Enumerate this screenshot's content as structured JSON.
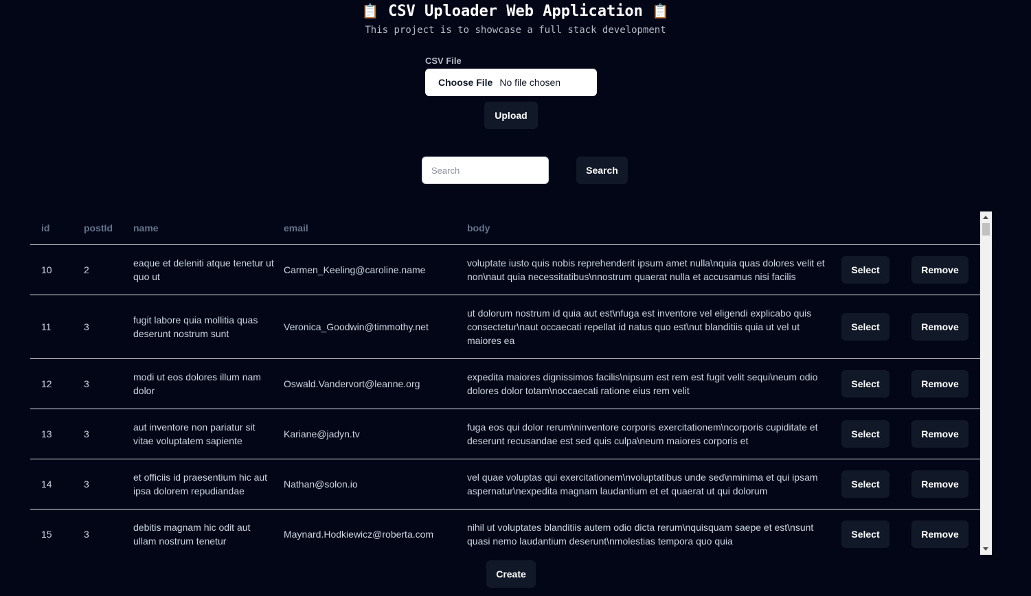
{
  "header": {
    "icon_left": "📋",
    "title": "CSV Uploader Web Application",
    "icon_right": "📋",
    "subtitle": "This project is to showcase a full stack development"
  },
  "upload": {
    "label": "CSV File",
    "choose_label": "Choose File",
    "file_status": "No file chosen",
    "button": "Upload"
  },
  "search": {
    "placeholder": "Search",
    "value": "",
    "button": "Search"
  },
  "table": {
    "columns": [
      "id",
      "postId",
      "name",
      "email",
      "body"
    ],
    "select_label": "Select",
    "remove_label": "Remove",
    "rows": [
      {
        "id": "10",
        "postId": "2",
        "name": "eaque et deleniti atque tenetur ut quo ut",
        "email": "Carmen_Keeling@caroline.name",
        "body": "voluptate iusto quis nobis reprehenderit ipsum amet nulla\\nquia quas dolores velit et non\\naut quia necessitatibus\\nnostrum quaerat nulla et accusamus nisi facilis"
      },
      {
        "id": "11",
        "postId": "3",
        "name": "fugit labore quia mollitia quas deserunt nostrum sunt",
        "email": "Veronica_Goodwin@timmothy.net",
        "body": "ut dolorum nostrum id quia aut est\\nfuga est inventore vel eligendi explicabo quis consectetur\\naut occaecati repellat id natus quo est\\nut blanditiis quia ut vel ut maiores ea"
      },
      {
        "id": "12",
        "postId": "3",
        "name": "modi ut eos dolores illum nam dolor",
        "email": "Oswald.Vandervort@leanne.org",
        "body": "expedita maiores dignissimos facilis\\nipsum est rem est fugit velit sequi\\neum odio dolores dolor totam\\noccaecati ratione eius rem velit"
      },
      {
        "id": "13",
        "postId": "3",
        "name": "aut inventore non pariatur sit vitae voluptatem sapiente",
        "email": "Kariane@jadyn.tv",
        "body": "fuga eos qui dolor rerum\\ninventore corporis exercitationem\\ncorporis cupiditate et deserunt recusandae est sed quis culpa\\neum maiores corporis et"
      },
      {
        "id": "14",
        "postId": "3",
        "name": "et officiis id praesentium hic aut ipsa dolorem repudiandae",
        "email": "Nathan@solon.io",
        "body": "vel quae voluptas qui exercitationem\\nvoluptatibus unde sed\\nminima et qui ipsam aspernatur\\nexpedita magnam laudantium et et quaerat ut qui dolorum"
      },
      {
        "id": "15",
        "postId": "3",
        "name": "debitis magnam hic odit aut ullam nostrum tenetur",
        "email": "Maynard.Hodkiewicz@roberta.com",
        "body": "nihil ut voluptates blanditiis autem odio dicta rerum\\nquisquam saepe et est\\nsunt quasi nemo laudantium deserunt\\nmolestias tempora quo quia"
      }
    ]
  },
  "footer": {
    "create_button": "Create"
  },
  "colors": {
    "background": "#030617",
    "button": "#111827",
    "divider": "#e5e7eb",
    "header_text": "#64748b"
  }
}
